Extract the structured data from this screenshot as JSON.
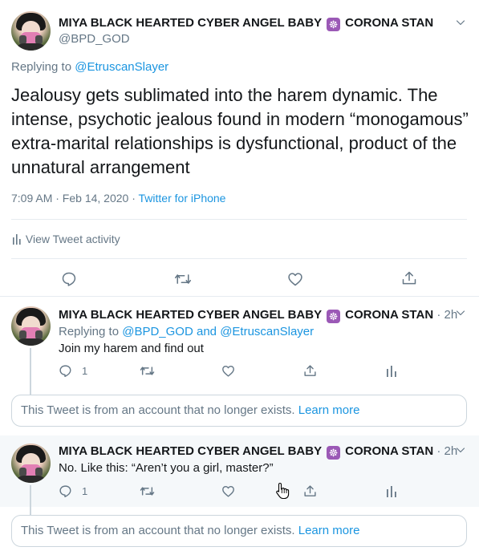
{
  "main_tweet": {
    "display_name": "MIYA BLACK HEARTED CYBER ANGEL BABY",
    "name_suffix": "CORONA STAN",
    "emoji": "☸",
    "handle": "@BPD_GOD",
    "replying_label": "Replying to",
    "replying_to": "@EtruscanSlayer",
    "text": "Jealousy gets sublimated into the harem dynamic. The intense, psychotic jealous found in modern “monogamous” extra-marital relationships is dysfunctional, product of the unnatural arrangement",
    "time_date": "7:09 AM · Feb 14, 2020",
    "separator": "·",
    "source": "Twitter for iPhone",
    "activity_label": "View Tweet activity"
  },
  "reply1": {
    "display_name": "MIYA BLACK HEARTED CYBER ANGEL BABY",
    "name_suffix": "CORONA STAN",
    "emoji": "☸",
    "time": "· 2h",
    "replying_label": "Replying to",
    "replying_to_1": "@BPD_GOD",
    "replying_and": "and",
    "replying_to_2": "@EtruscanSlayer",
    "text": "Join my harem and find out",
    "reply_count": "1"
  },
  "notice1": {
    "text": "This Tweet is from an account that no longer exists.",
    "link": "Learn more"
  },
  "reply2": {
    "display_name": "MIYA BLACK HEARTED CYBER ANGEL BABY",
    "name_suffix": "CORONA STAN",
    "emoji": "☸",
    "time": "· 2h",
    "text": "No. Like this: “Aren’t you a girl, master?”",
    "reply_count": "1"
  },
  "notice2": {
    "text": "This Tweet is from an account that no longer exists.",
    "link": "Learn more"
  },
  "colors": {
    "link": "#1b95e0",
    "secondary": "#657786",
    "divider": "#e6ecf0",
    "hover_bg": "#f5f8fa"
  }
}
